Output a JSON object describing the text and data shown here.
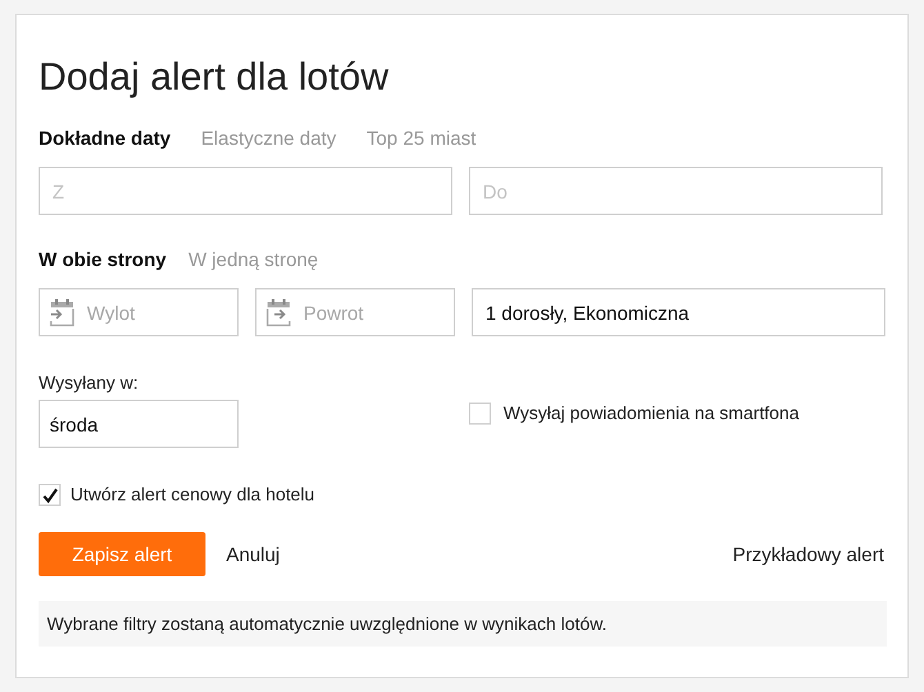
{
  "title": "Dodaj alert dla lotów",
  "date_tabs": [
    {
      "label": "Dokładne daty",
      "selected": true
    },
    {
      "label": "Elastyczne daty",
      "selected": false
    },
    {
      "label": "Top 25 miast",
      "selected": false
    }
  ],
  "route": {
    "from": {
      "placeholder": "Z"
    },
    "to": {
      "placeholder": "Do"
    }
  },
  "trip_tabs": [
    {
      "label": "W obie strony",
      "selected": true
    },
    {
      "label": "W jedną stronę",
      "selected": false
    }
  ],
  "dates": [
    {
      "placeholder": "Wylot"
    },
    {
      "placeholder": "Powrot"
    }
  ],
  "passengers": {
    "value": "1 dorosły, Ekonomiczna"
  },
  "sent_on": {
    "label": "Wysyłany w:",
    "value": "środa"
  },
  "smartphone": {
    "label": "Wysyłaj powiadomienia na smartfona",
    "checked": false
  },
  "hotel": {
    "label": "Utwórz alert cenowy dla hotelu",
    "checked": true
  },
  "buttons": {
    "save": "Zapisz alert",
    "cancel": "Anuluj",
    "example": "Przykładowy alert"
  },
  "info": "Wybrane filtry zostaną automatycznie uwzględnione w wynikach lotów."
}
